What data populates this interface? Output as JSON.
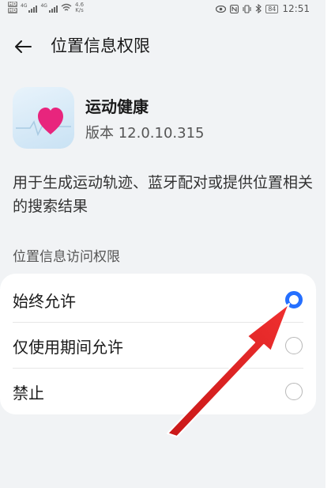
{
  "status_bar": {
    "signal_label_1": "4G",
    "signal_label_2": "4G",
    "net_speed_value": "4.6",
    "net_speed_unit": "K/s",
    "battery": "84",
    "time": "12:51"
  },
  "header": {
    "title": "位置信息权限"
  },
  "app": {
    "name": "运动健康",
    "version": "版本 12.0.10.315"
  },
  "description": "用于生成运动轨迹、蓝牙配对或提供位置相关的搜索结果",
  "section_label": "位置信息访问权限",
  "options": [
    {
      "label": "始终允许",
      "selected": true
    },
    {
      "label": "仅使用期间允许",
      "selected": false
    },
    {
      "label": "禁止",
      "selected": false
    }
  ],
  "colors": {
    "accent": "#256fff",
    "annotation_arrow": "#e02020",
    "background": "#f1f3f5"
  },
  "icons": {
    "back": "back-arrow-icon",
    "app": "heart-icon"
  }
}
